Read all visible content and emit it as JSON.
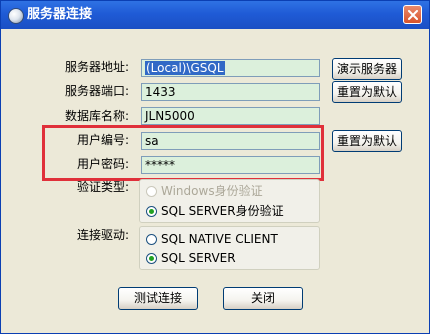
{
  "window": {
    "title": "服务器连接"
  },
  "form": {
    "server_address": {
      "label": "服务器地址:",
      "value": "(Local)\\GSQL"
    },
    "server_port": {
      "label": "服务器端口:",
      "value": "1433"
    },
    "database_name": {
      "label": "数据库名称:",
      "value": "JLN5000"
    },
    "user_id": {
      "label": "用户编号:",
      "value": "sa"
    },
    "user_password": {
      "label": "用户密码:",
      "value": "*****"
    }
  },
  "buttons": {
    "demo_server": "演示服务器",
    "reset_default_1": "重置为默认",
    "reset_default_2": "重置为默认",
    "test_connection": "测试连接",
    "close": "关闭"
  },
  "auth": {
    "label": "验证类型:",
    "options": [
      {
        "label": "Windows身份验证",
        "selected": false,
        "enabled": false
      },
      {
        "label": "SQL SERVER身份验证",
        "selected": true,
        "enabled": true
      }
    ]
  },
  "driver": {
    "label": "连接驱动:",
    "options": [
      {
        "label": "SQL NATIVE CLIENT",
        "selected": false
      },
      {
        "label": "SQL SERVER",
        "selected": true
      }
    ]
  },
  "colors": {
    "titlebar": "#1f5bd6",
    "field_bg": "#dcf0dc",
    "highlight": "#e0303a",
    "selection": "#3169c6"
  }
}
